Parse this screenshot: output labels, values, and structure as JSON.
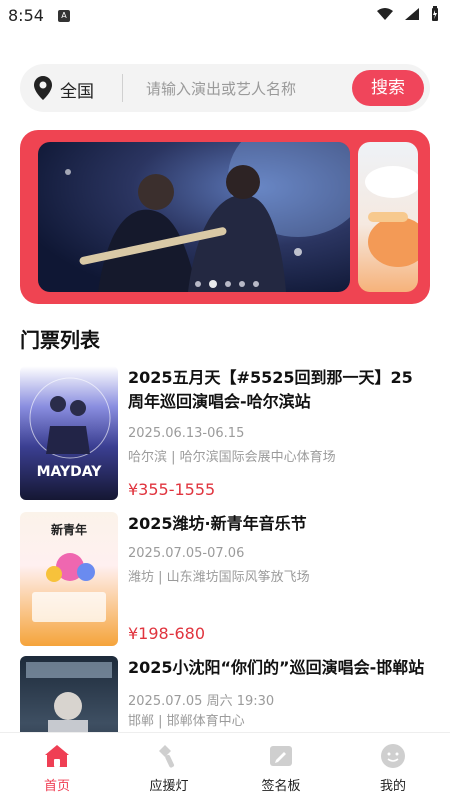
{
  "status": {
    "time": "8:54",
    "app_icon_letter": "A"
  },
  "search": {
    "city": "全国",
    "placeholder": "请输入演出或艺人名称",
    "button": "搜索"
  },
  "banner": {
    "active_index": 1,
    "dots": 5
  },
  "section": {
    "title": "门票列表"
  },
  "tickets": [
    {
      "title": "2025五月天【#5525回到那一天】25周年巡回演唱会-哈尔滨站",
      "date": "2025.06.13-06.15",
      "venue": "哈尔滨 | 哈尔滨国际会展中心体育场",
      "price": "¥355-1555",
      "poster_text": "MAYDAY"
    },
    {
      "title": "2025潍坊·新青年音乐节",
      "date": "2025.07.05-07.06",
      "venue": "潍坊 | 山东潍坊国际风筝放飞场",
      "price": "¥198-680",
      "poster_text": "新青年"
    },
    {
      "title": "2025小沈阳“你们的”巡回演唱会-邯郸站",
      "date": "2025.07.05 周六 19:30",
      "venue": "邯郸 | 邯郸体育中心",
      "price": ""
    }
  ],
  "nav": {
    "items": [
      {
        "label": "首页",
        "icon": "home-icon",
        "active": true
      },
      {
        "label": "应援灯",
        "icon": "lightstick-icon",
        "active": false
      },
      {
        "label": "签名板",
        "icon": "signboard-icon",
        "active": false
      },
      {
        "label": "我的",
        "icon": "profile-icon",
        "active": false
      }
    ]
  },
  "colors": {
    "accent": "#f0455b",
    "banner_bg": "#ef4452",
    "price": "#e0343e"
  }
}
